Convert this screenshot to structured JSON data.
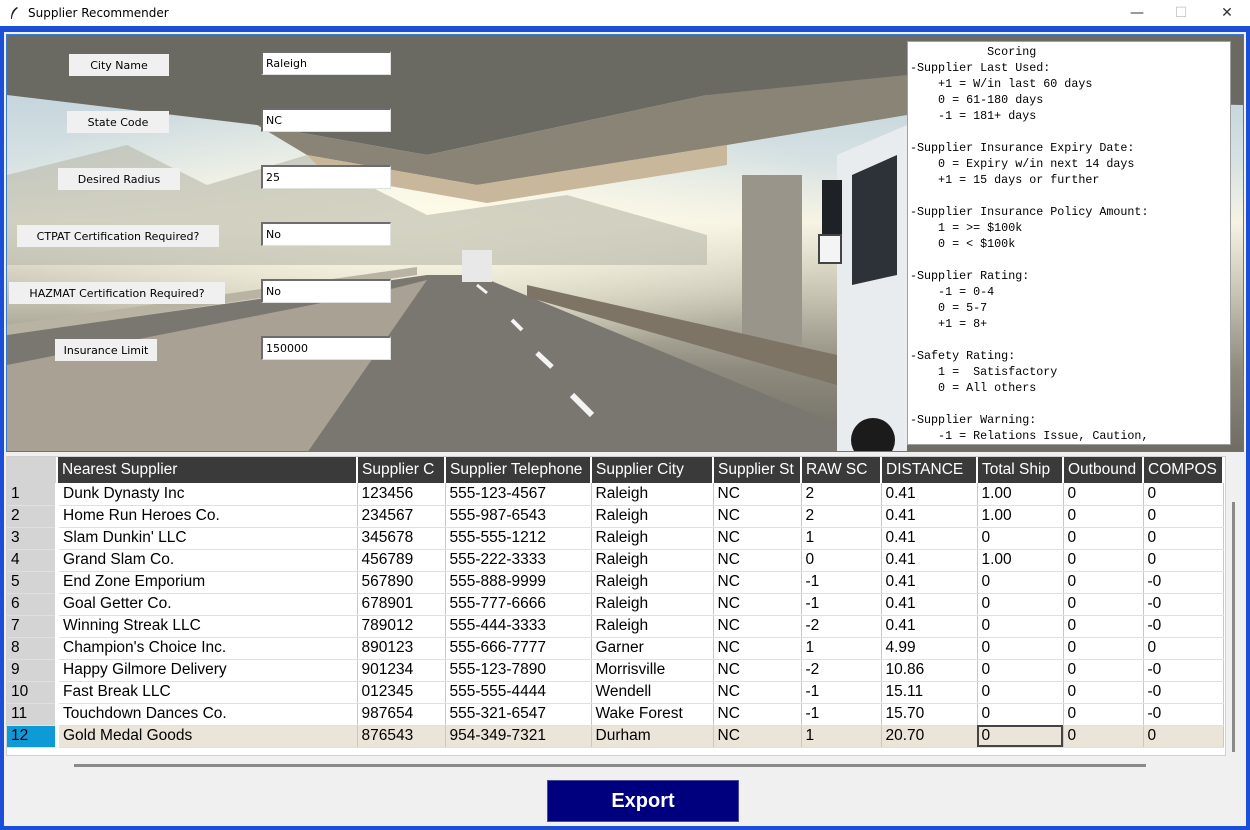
{
  "window": {
    "title": "Supplier Recommender",
    "minimize": "—",
    "maximize": "☐",
    "close": "✕"
  },
  "form": {
    "fields": [
      {
        "label": "City Name",
        "value": "Raleigh"
      },
      {
        "label": "State Code",
        "value": "NC"
      },
      {
        "label": "Desired Radius",
        "value": "25"
      },
      {
        "label": "CTPAT Certification Required?",
        "value": "No"
      },
      {
        "label": "HAZMAT Certification Required?",
        "value": "No"
      },
      {
        "label": "Insurance Limit",
        "value": "150000"
      }
    ]
  },
  "scoring": {
    "text": "           Scoring\n-Supplier Last Used:\n    +1 = W/in last 60 days\n    0 = 61-180 days\n    -1 = 181+ days\n\n-Supplier Insurance Expiry Date:\n    0 = Expiry w/in next 14 days\n    +1 = 15 days or further\n\n-Supplier Insurance Policy Amount:\n    1 = >= $100k\n    0 = < $100k\n\n-Supplier Rating:\n    -1 = 0-4\n    0 = 5-7\n    +1 = 8+\n\n-Safety Rating:\n    1 =  Satisfactory\n    0 = All others\n\n-Supplier Warning:\n    -1 = Relations Issue, Caution,"
  },
  "table": {
    "columns": [
      "",
      "Nearest Supplier",
      "Supplier C",
      "Supplier Telephone",
      "Supplier City",
      "Supplier St",
      "RAW SC",
      "DISTANCE",
      "Total Ship",
      "Outbound",
      "COMPOS"
    ],
    "rows": [
      [
        "1",
        "Dunk Dynasty Inc",
        "123456",
        "555-123-4567",
        "Raleigh",
        "NC",
        "2",
        "0.41",
        "1.00",
        "0",
        "0"
      ],
      [
        "2",
        "Home Run Heroes Co.",
        "234567",
        "555-987-6543",
        "Raleigh",
        "NC",
        "2",
        "0.41",
        "1.00",
        "0",
        "0"
      ],
      [
        "3",
        "Slam Dunkin' LLC",
        "345678",
        "555-555-1212",
        "Raleigh",
        "NC",
        "1",
        "0.41",
        "0",
        "0",
        "0"
      ],
      [
        "4",
        "Grand Slam Co.",
        "456789",
        "555-222-3333",
        "Raleigh",
        "NC",
        "0",
        "0.41",
        "1.00",
        "0",
        "0"
      ],
      [
        "5",
        "End Zone Emporium",
        "567890",
        "555-888-9999",
        "Raleigh",
        "NC",
        "-1",
        "0.41",
        "0",
        "0",
        "-0"
      ],
      [
        "6",
        "Goal Getter Co.",
        "678901",
        "555-777-6666",
        "Raleigh",
        "NC",
        "-1",
        "0.41",
        "0",
        "0",
        "-0"
      ],
      [
        "7",
        "Winning Streak LLC",
        "789012",
        "555-444-3333",
        "Raleigh",
        "NC",
        "-2",
        "0.41",
        "0",
        "0",
        "-0"
      ],
      [
        "8",
        "Champion's Choice Inc.",
        "890123",
        "555-666-7777",
        "Garner",
        "NC",
        "1",
        "4.99",
        "0",
        "0",
        "0"
      ],
      [
        "9",
        "Happy Gilmore Delivery",
        "901234",
        "555-123-7890",
        "Morrisville",
        "NC",
        "-2",
        "10.86",
        "0",
        "0",
        "-0"
      ],
      [
        "10",
        "Fast Break LLC",
        "012345",
        "555-555-4444",
        "Wendell",
        "NC",
        "-1",
        "15.11",
        "0",
        "0",
        "-0"
      ],
      [
        "11",
        "Touchdown Dances Co.",
        "987654",
        "555-321-6547",
        "Wake Forest",
        "NC",
        "-1",
        "15.70",
        "0",
        "0",
        "-0"
      ],
      [
        "12",
        "Gold Medal Goods",
        "876543",
        "954-349-7321",
        "Durham",
        "NC",
        "1",
        "20.70",
        "0",
        "0",
        "0"
      ]
    ],
    "selected_row": 11
  },
  "export_label": "Export",
  "colors": {
    "frame_border": "#1c4fd8",
    "header_bg": "#3a3a3a",
    "selected_index": "#0e9ad6",
    "export_bg": "#00007f"
  }
}
